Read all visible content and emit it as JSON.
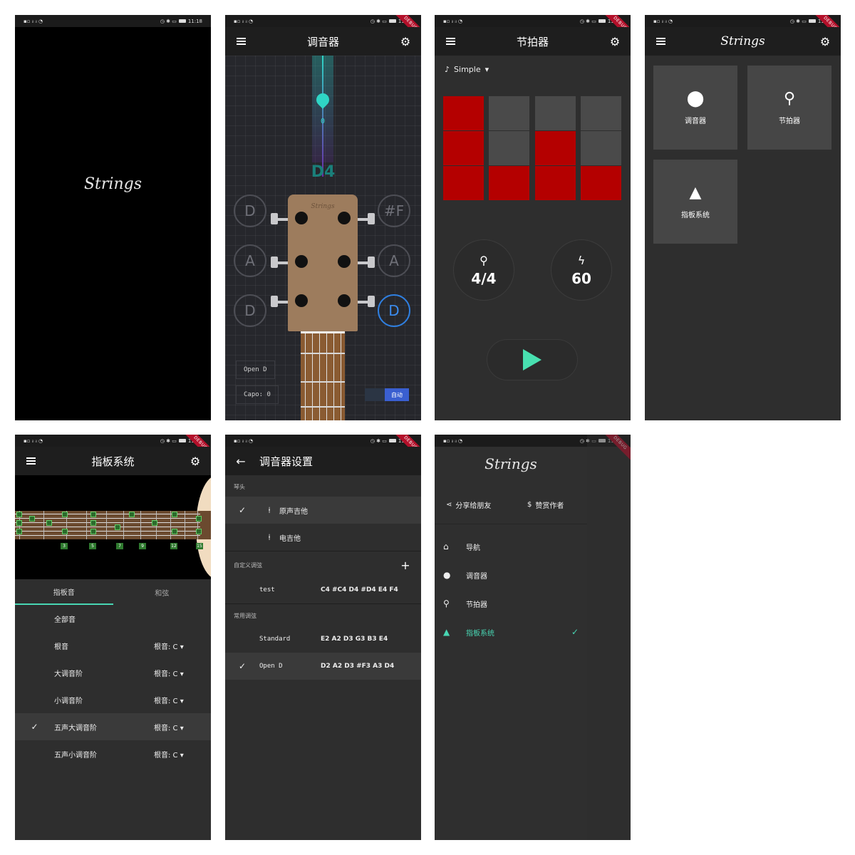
{
  "status": {
    "time_1": "11:18",
    "time_other": "11:18",
    "debug": "DEBUG"
  },
  "p1": {
    "logo": "Strings"
  },
  "p2": {
    "title": "调音器",
    "cents": "0",
    "note": "D4",
    "headstock_logo": "Strings",
    "left_strings": [
      "D",
      "A",
      "D"
    ],
    "right_strings": [
      "#F",
      "A",
      "D"
    ],
    "tuning": "Open D",
    "capo": "Capo: 0",
    "auto": "自动"
  },
  "p3": {
    "title": "节拍器",
    "mode": "Simple",
    "time_sig": "4/4",
    "bpm": "60"
  },
  "p4": {
    "logo": "Strings",
    "tiles": [
      "调音器",
      "节拍器",
      "指板系统"
    ]
  },
  "p5": {
    "title": "指板系统",
    "tabs": [
      "指板音",
      "和弦"
    ],
    "fret_numbers": [
      "3",
      "5",
      "7",
      "9",
      "12",
      "15"
    ],
    "rows": [
      {
        "name": "全部音",
        "root": ""
      },
      {
        "name": "根音",
        "root": "根音: C ▾"
      },
      {
        "name": "大调音阶",
        "root": "根音: C ▾"
      },
      {
        "name": "小调音阶",
        "root": "根音: C ▾"
      },
      {
        "name": "五声大调音阶",
        "root": "根音: C ▾"
      },
      {
        "name": "五声小调音阶",
        "root": "根音: C ▾"
      }
    ]
  },
  "p6": {
    "title": "调音器设置",
    "sec_head": "琴头",
    "acoustic": "原声吉他",
    "electric": "电吉他",
    "sec_custom": "自定义调弦",
    "custom_name": "test",
    "custom_tuning": "C4 #C4 D4 #D4 E4 F4",
    "sec_common": "常用调弦",
    "std_name": "Standard",
    "std_tuning": "E2 A2 D3 G3 B3 E4",
    "open_name": "Open D",
    "open_tuning": "D2 A2 D3 #F3 A3 D4"
  },
  "p7": {
    "logo": "Strings",
    "share": "分享给朋友",
    "donate": "赞赏作者",
    "nav": [
      "导航",
      "调音器",
      "节拍器",
      "指板系统"
    ]
  }
}
